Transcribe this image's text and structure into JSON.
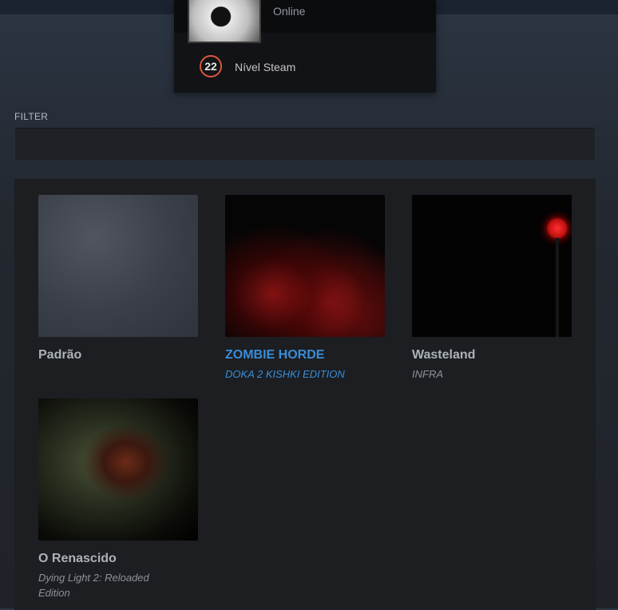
{
  "profile": {
    "status": "Online",
    "level": "22",
    "level_label": "Nível Steam"
  },
  "filter": {
    "label": "FILTER",
    "value": ""
  },
  "items": [
    {
      "title": "Padrão",
      "subtitle": ""
    },
    {
      "title": "ZOMBIE HORDE",
      "subtitle": "DOKA 2 KISHKI EDITION",
      "selected": true
    },
    {
      "title": "Wasteland",
      "subtitle": "INFRA"
    },
    {
      "title": "O Renascido",
      "subtitle": "Dying Light 2: Reloaded Edition"
    }
  ],
  "colors": {
    "accent": "#3a8dd6",
    "level_ring": "#d9573d"
  }
}
